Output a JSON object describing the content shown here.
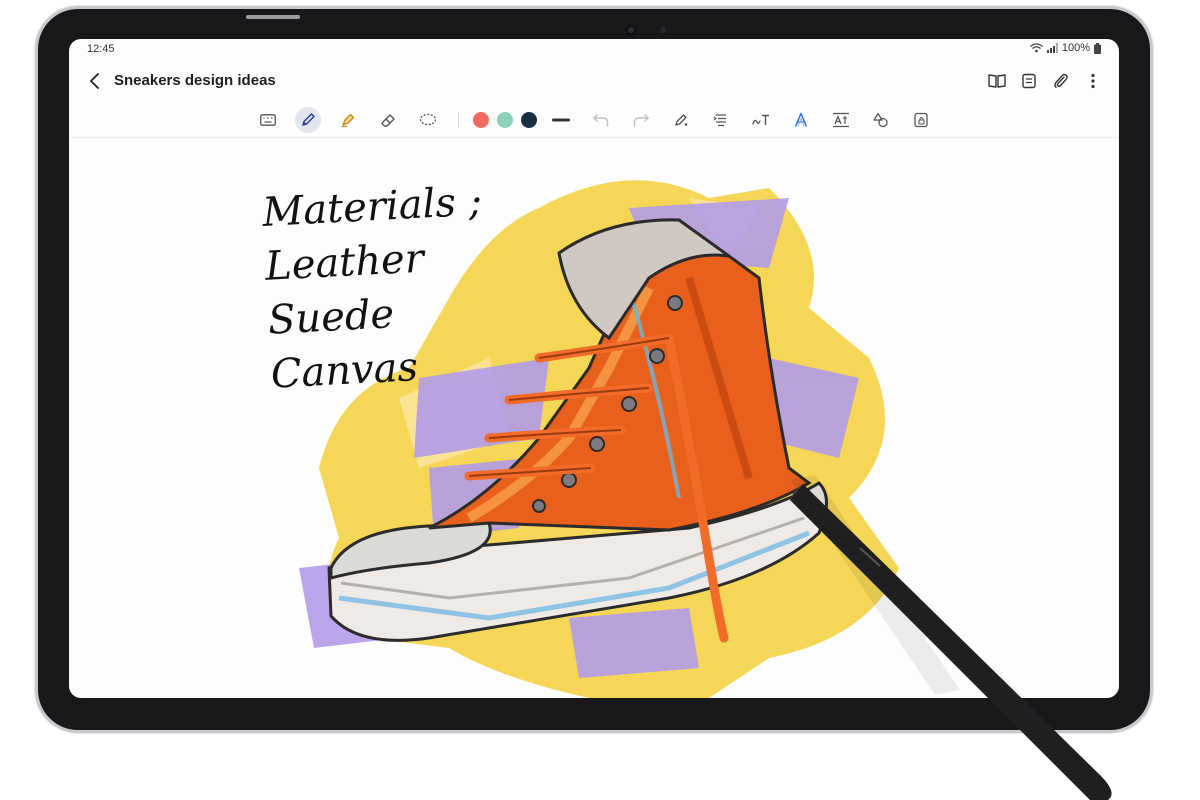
{
  "status_bar": {
    "time": "12:45",
    "battery": "100%"
  },
  "app_bar": {
    "title": "Sneakers design ideas",
    "back_icon": "back-arrow-icon",
    "actions": [
      "book-icon",
      "page-layout-icon",
      "attach-icon",
      "more-icon"
    ]
  },
  "toolbar": {
    "tools": [
      "keyboard-icon",
      "pen-icon",
      "highlighter-icon",
      "eraser-icon",
      "lasso-icon"
    ],
    "colors": [
      "#f06c62",
      "#8dd1bd",
      "#163040"
    ],
    "actions": [
      "undo-icon",
      "redo-icon",
      "pen-settings-icon",
      "text-format-icon",
      "handwriting-to-text-icon",
      "text-style-icon",
      "text-box-icon",
      "shapes-icon",
      "lock-icon"
    ]
  },
  "note": {
    "handwriting": [
      "Materials ;",
      "Leather",
      "Suede",
      "Canvas"
    ]
  }
}
